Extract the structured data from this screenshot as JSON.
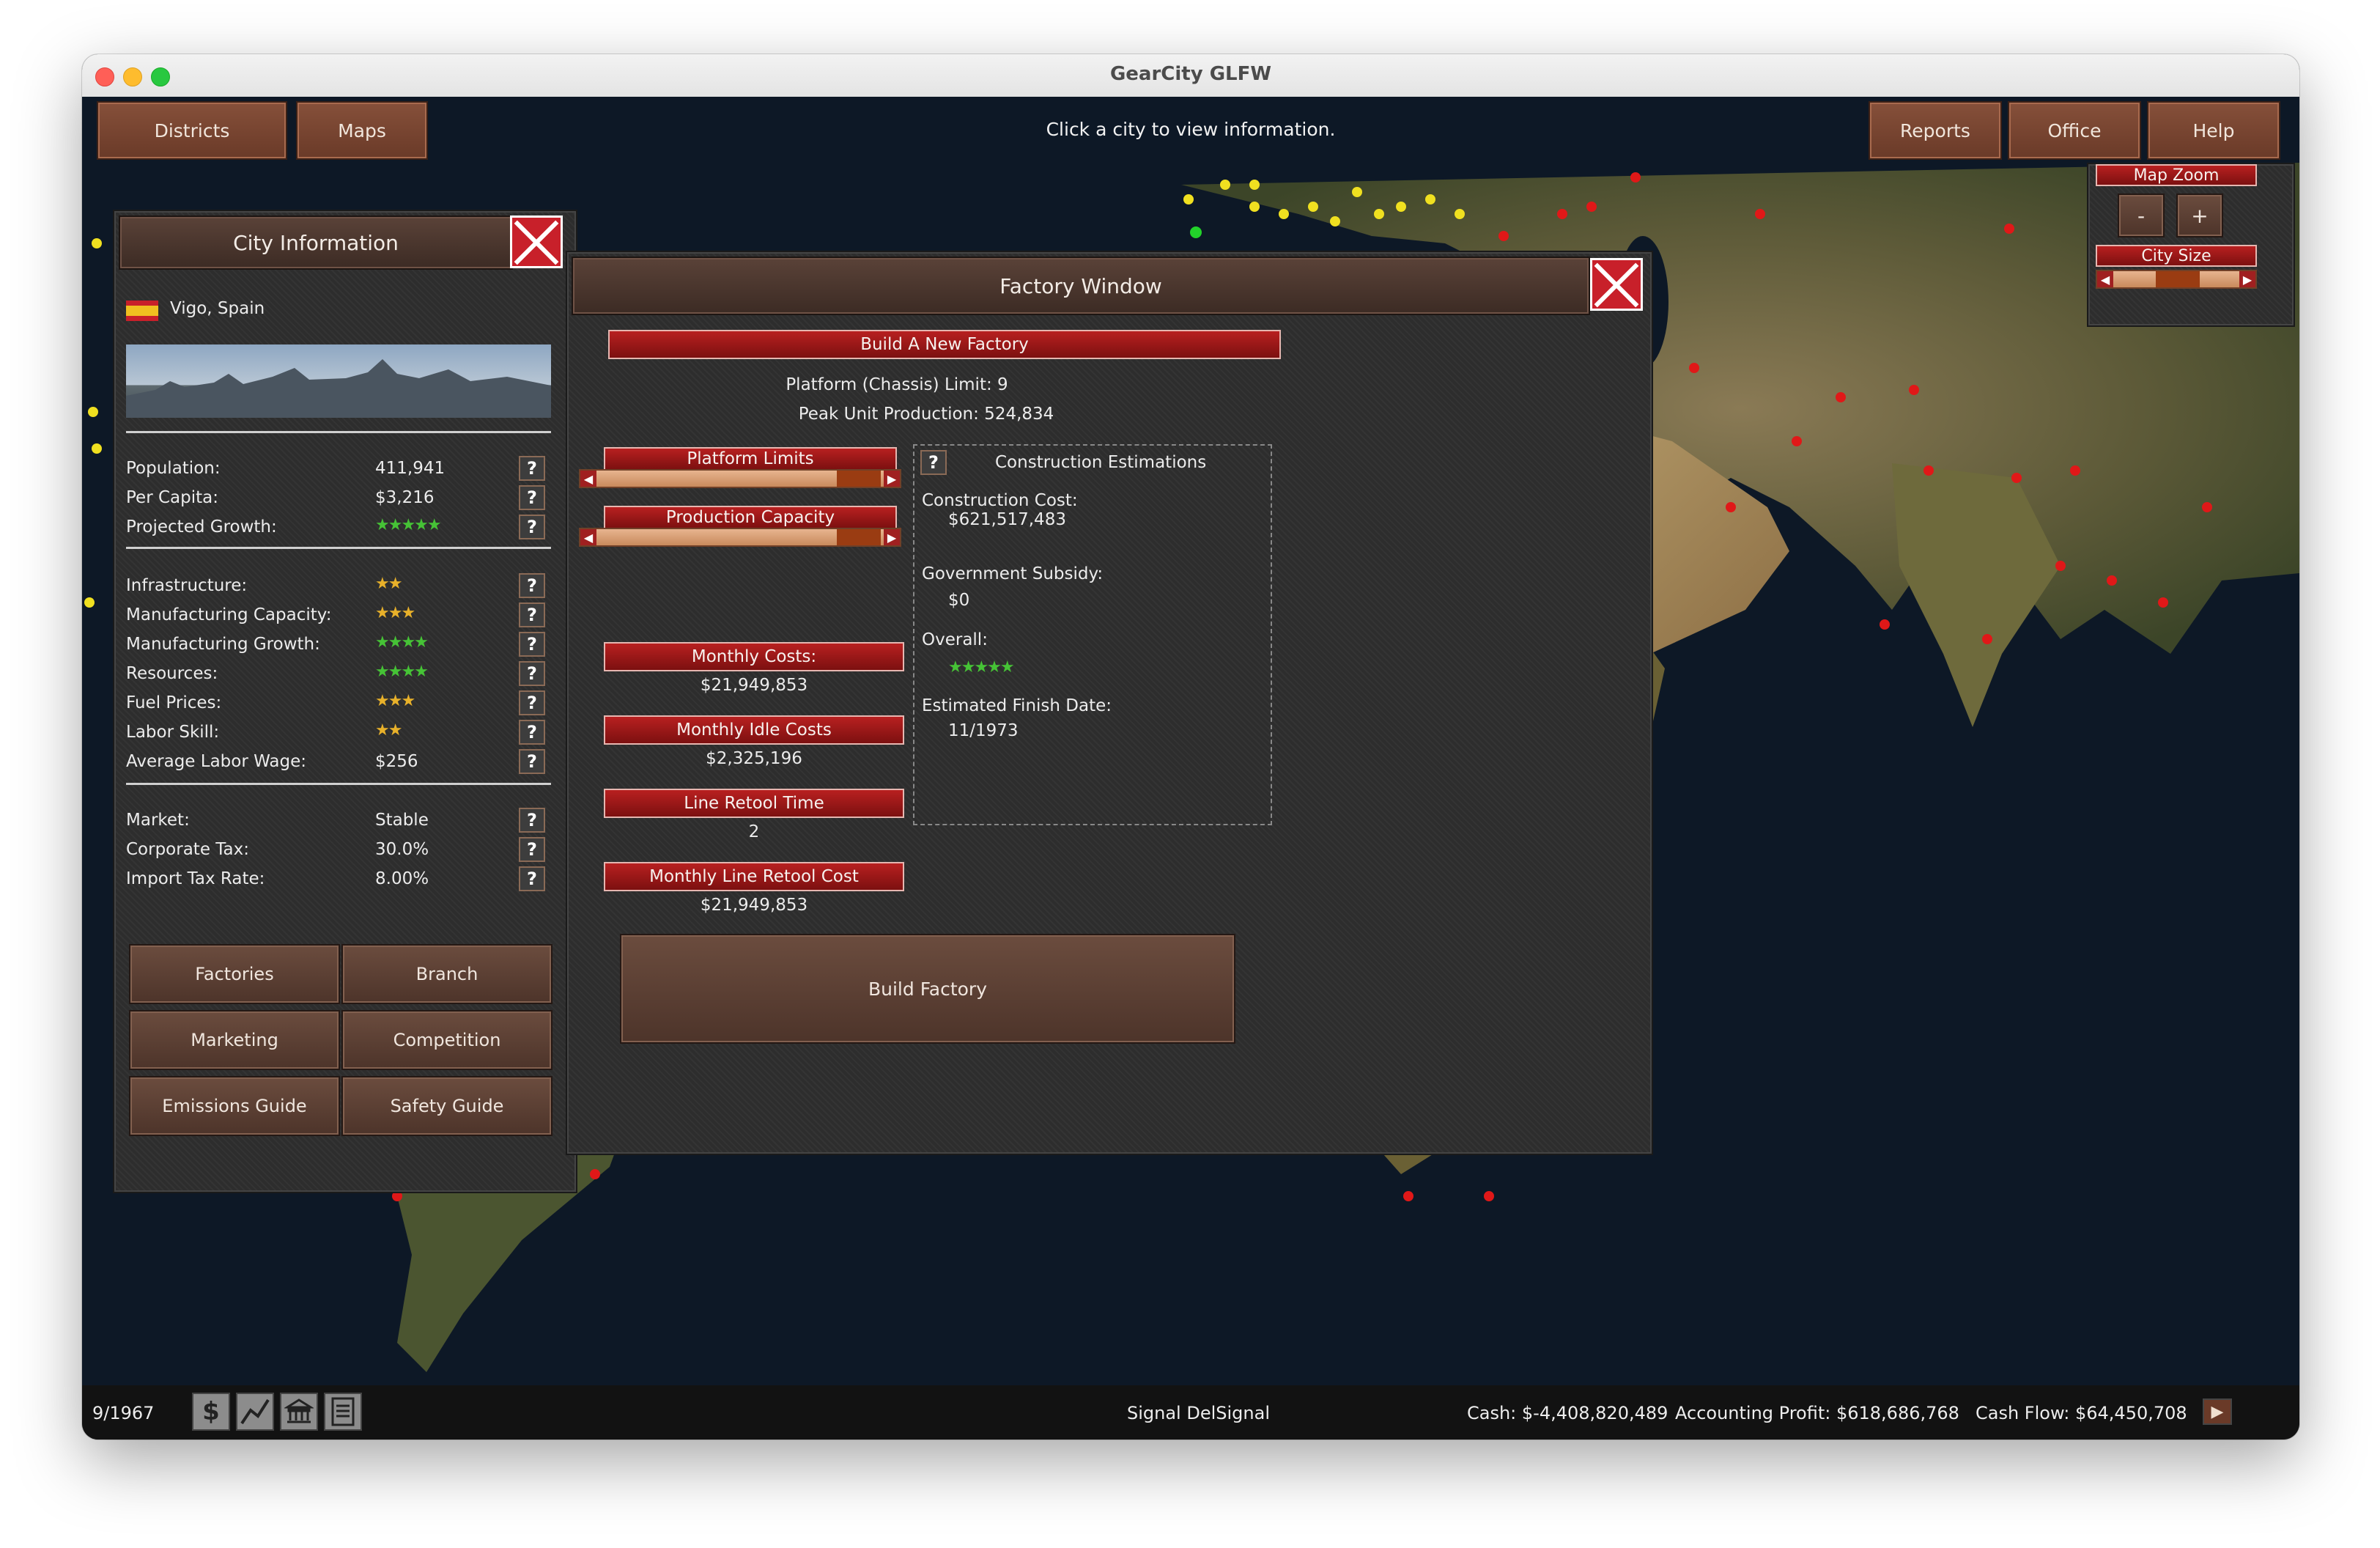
{
  "window": {
    "title": "GearCity GLFW"
  },
  "topbar": {
    "districts": "Districts",
    "maps": "Maps",
    "hint": "Click  a  city  to  view  information.",
    "reports": "Reports",
    "office": "Office",
    "help": "Help"
  },
  "zoom_panel": {
    "map_zoom": "Map  Zoom",
    "minus": "-",
    "plus": "+",
    "city_size": "City  Size"
  },
  "city_info": {
    "title": "City  Information",
    "city": "Vigo,  Spain",
    "stats": [
      {
        "label": "Population:",
        "value": "411,941"
      },
      {
        "label": "Per  Capita:",
        "value": "$3,216"
      },
      {
        "label": "Projected  Growth:",
        "stars": "★★★★★",
        "rating": 5
      }
    ],
    "ratings": [
      {
        "label": "Infrastructure:",
        "stars": "★★",
        "rating": 2
      },
      {
        "label": "Manufacturing  Capacity:",
        "stars": "★★★",
        "rating": 2.5
      },
      {
        "label": "Manufacturing  Growth:",
        "stars": "★★★★",
        "rating": 4
      },
      {
        "label": "Resources:",
        "stars": "★★★★",
        "rating": 3.5
      },
      {
        "label": "Fuel  Prices:",
        "stars": "★★★",
        "rating": 2.5
      },
      {
        "label": "Labor  Skill:",
        "stars": "★★",
        "rating": 2
      },
      {
        "label": "Average  Labor  Wage:",
        "value": "$256"
      }
    ],
    "market": [
      {
        "label": "Market:",
        "value": "Stable"
      },
      {
        "label": "Corporate  Tax:",
        "value": "30.0%"
      },
      {
        "label": "Import  Tax  Rate:",
        "value": "8.00%"
      }
    ],
    "buttons": {
      "factories": "Factories",
      "branch": "Branch",
      "marketing": "Marketing",
      "competition": "Competition",
      "emissions": "Emissions  Guide",
      "safety": "Safety  Guide"
    }
  },
  "factory": {
    "title": "Factory  Window",
    "build_new": "Build  A  New  Factory",
    "platform_limit": "Platform  (Chassis)  Limit: 9",
    "peak_production": "Peak  Unit  Production: 524,834",
    "platform_limits_label": "Platform  Limits",
    "production_capacity_label": "Production  Capacity",
    "monthly_costs_label": "Monthly  Costs:",
    "monthly_costs": "$21,949,853",
    "monthly_idle_label": "Monthly  Idle  Costs",
    "monthly_idle": "$2,325,196",
    "retool_time_label": "Line  Retool  Time",
    "retool_time": "2",
    "retool_cost_label": "Monthly  Line  Retool  Cost",
    "retool_cost": "$21,949,853",
    "estimations": {
      "title": "Construction  Estimations",
      "cost_label": "Construction  Cost:",
      "cost": "$621,517,483",
      "subsidy_label": "Government  Subsidy:",
      "subsidy": "$0",
      "overall_label": "Overall:",
      "overall_stars": "★★★★★",
      "overall_rating": 4.5,
      "finish_label": "Estimated  Finish  Date:",
      "finish": "11/1973"
    },
    "build_button": "Build  Factory"
  },
  "statusbar": {
    "date": "9/1967",
    "signal": "Signal  DelSignal",
    "cash": "Cash:  $-4,408,820,489",
    "profit": "Accounting  Profit:  $618,686,768",
    "cashflow": "Cash  Flow:  $64,450,708"
  },
  "colors": {
    "city_dot_red": "#e01818",
    "city_dot_yellow": "#f0e020",
    "city_dot_green": "#22d22a",
    "accent_red": "#b82020",
    "button_brown": "#6a3a28"
  }
}
